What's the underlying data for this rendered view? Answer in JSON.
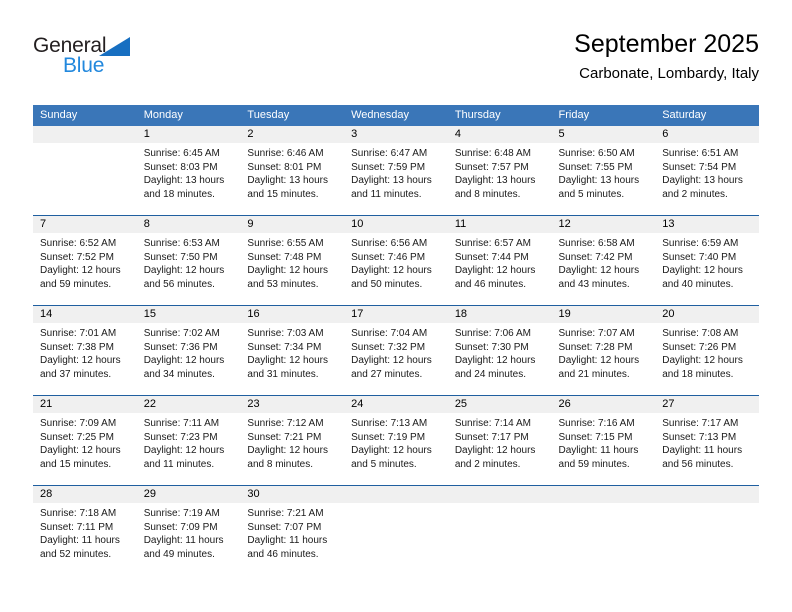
{
  "brand": {
    "name_part1": "General",
    "name_part2": "Blue",
    "triangle_icon": "triangle-icon",
    "colors": {
      "dark": "#231f20",
      "blue": "#2288dd",
      "triangle": "#176fc1"
    }
  },
  "header": {
    "title": "September 2025",
    "subtitle": "Carbonate, Lombardy, Italy"
  },
  "calendar": {
    "header_bg": "#3a76b8",
    "daynum_bg": "#f0f0f0",
    "row_divider": "#1f5fa0",
    "weekdays": [
      "Sunday",
      "Monday",
      "Tuesday",
      "Wednesday",
      "Thursday",
      "Friday",
      "Saturday"
    ],
    "weeks": [
      [
        {
          "day": "",
          "sunrise": "",
          "sunset": "",
          "daylight1": "",
          "daylight2": "",
          "empty": true
        },
        {
          "day": "1",
          "sunrise": "Sunrise: 6:45 AM",
          "sunset": "Sunset: 8:03 PM",
          "daylight1": "Daylight: 13 hours",
          "daylight2": "and 18 minutes."
        },
        {
          "day": "2",
          "sunrise": "Sunrise: 6:46 AM",
          "sunset": "Sunset: 8:01 PM",
          "daylight1": "Daylight: 13 hours",
          "daylight2": "and 15 minutes."
        },
        {
          "day": "3",
          "sunrise": "Sunrise: 6:47 AM",
          "sunset": "Sunset: 7:59 PM",
          "daylight1": "Daylight: 13 hours",
          "daylight2": "and 11 minutes."
        },
        {
          "day": "4",
          "sunrise": "Sunrise: 6:48 AM",
          "sunset": "Sunset: 7:57 PM",
          "daylight1": "Daylight: 13 hours",
          "daylight2": "and 8 minutes."
        },
        {
          "day": "5",
          "sunrise": "Sunrise: 6:50 AM",
          "sunset": "Sunset: 7:55 PM",
          "daylight1": "Daylight: 13 hours",
          "daylight2": "and 5 minutes."
        },
        {
          "day": "6",
          "sunrise": "Sunrise: 6:51 AM",
          "sunset": "Sunset: 7:54 PM",
          "daylight1": "Daylight: 13 hours",
          "daylight2": "and 2 minutes."
        }
      ],
      [
        {
          "day": "7",
          "sunrise": "Sunrise: 6:52 AM",
          "sunset": "Sunset: 7:52 PM",
          "daylight1": "Daylight: 12 hours",
          "daylight2": "and 59 minutes."
        },
        {
          "day": "8",
          "sunrise": "Sunrise: 6:53 AM",
          "sunset": "Sunset: 7:50 PM",
          "daylight1": "Daylight: 12 hours",
          "daylight2": "and 56 minutes."
        },
        {
          "day": "9",
          "sunrise": "Sunrise: 6:55 AM",
          "sunset": "Sunset: 7:48 PM",
          "daylight1": "Daylight: 12 hours",
          "daylight2": "and 53 minutes."
        },
        {
          "day": "10",
          "sunrise": "Sunrise: 6:56 AM",
          "sunset": "Sunset: 7:46 PM",
          "daylight1": "Daylight: 12 hours",
          "daylight2": "and 50 minutes."
        },
        {
          "day": "11",
          "sunrise": "Sunrise: 6:57 AM",
          "sunset": "Sunset: 7:44 PM",
          "daylight1": "Daylight: 12 hours",
          "daylight2": "and 46 minutes."
        },
        {
          "day": "12",
          "sunrise": "Sunrise: 6:58 AM",
          "sunset": "Sunset: 7:42 PM",
          "daylight1": "Daylight: 12 hours",
          "daylight2": "and 43 minutes."
        },
        {
          "day": "13",
          "sunrise": "Sunrise: 6:59 AM",
          "sunset": "Sunset: 7:40 PM",
          "daylight1": "Daylight: 12 hours",
          "daylight2": "and 40 minutes."
        }
      ],
      [
        {
          "day": "14",
          "sunrise": "Sunrise: 7:01 AM",
          "sunset": "Sunset: 7:38 PM",
          "daylight1": "Daylight: 12 hours",
          "daylight2": "and 37 minutes."
        },
        {
          "day": "15",
          "sunrise": "Sunrise: 7:02 AM",
          "sunset": "Sunset: 7:36 PM",
          "daylight1": "Daylight: 12 hours",
          "daylight2": "and 34 minutes."
        },
        {
          "day": "16",
          "sunrise": "Sunrise: 7:03 AM",
          "sunset": "Sunset: 7:34 PM",
          "daylight1": "Daylight: 12 hours",
          "daylight2": "and 31 minutes."
        },
        {
          "day": "17",
          "sunrise": "Sunrise: 7:04 AM",
          "sunset": "Sunset: 7:32 PM",
          "daylight1": "Daylight: 12 hours",
          "daylight2": "and 27 minutes."
        },
        {
          "day": "18",
          "sunrise": "Sunrise: 7:06 AM",
          "sunset": "Sunset: 7:30 PM",
          "daylight1": "Daylight: 12 hours",
          "daylight2": "and 24 minutes."
        },
        {
          "day": "19",
          "sunrise": "Sunrise: 7:07 AM",
          "sunset": "Sunset: 7:28 PM",
          "daylight1": "Daylight: 12 hours",
          "daylight2": "and 21 minutes."
        },
        {
          "day": "20",
          "sunrise": "Sunrise: 7:08 AM",
          "sunset": "Sunset: 7:26 PM",
          "daylight1": "Daylight: 12 hours",
          "daylight2": "and 18 minutes."
        }
      ],
      [
        {
          "day": "21",
          "sunrise": "Sunrise: 7:09 AM",
          "sunset": "Sunset: 7:25 PM",
          "daylight1": "Daylight: 12 hours",
          "daylight2": "and 15 minutes."
        },
        {
          "day": "22",
          "sunrise": "Sunrise: 7:11 AM",
          "sunset": "Sunset: 7:23 PM",
          "daylight1": "Daylight: 12 hours",
          "daylight2": "and 11 minutes."
        },
        {
          "day": "23",
          "sunrise": "Sunrise: 7:12 AM",
          "sunset": "Sunset: 7:21 PM",
          "daylight1": "Daylight: 12 hours",
          "daylight2": "and 8 minutes."
        },
        {
          "day": "24",
          "sunrise": "Sunrise: 7:13 AM",
          "sunset": "Sunset: 7:19 PM",
          "daylight1": "Daylight: 12 hours",
          "daylight2": "and 5 minutes."
        },
        {
          "day": "25",
          "sunrise": "Sunrise: 7:14 AM",
          "sunset": "Sunset: 7:17 PM",
          "daylight1": "Daylight: 12 hours",
          "daylight2": "and 2 minutes."
        },
        {
          "day": "26",
          "sunrise": "Sunrise: 7:16 AM",
          "sunset": "Sunset: 7:15 PM",
          "daylight1": "Daylight: 11 hours",
          "daylight2": "and 59 minutes."
        },
        {
          "day": "27",
          "sunrise": "Sunrise: 7:17 AM",
          "sunset": "Sunset: 7:13 PM",
          "daylight1": "Daylight: 11 hours",
          "daylight2": "and 56 minutes."
        }
      ],
      [
        {
          "day": "28",
          "sunrise": "Sunrise: 7:18 AM",
          "sunset": "Sunset: 7:11 PM",
          "daylight1": "Daylight: 11 hours",
          "daylight2": "and 52 minutes."
        },
        {
          "day": "29",
          "sunrise": "Sunrise: 7:19 AM",
          "sunset": "Sunset: 7:09 PM",
          "daylight1": "Daylight: 11 hours",
          "daylight2": "and 49 minutes."
        },
        {
          "day": "30",
          "sunrise": "Sunrise: 7:21 AM",
          "sunset": "Sunset: 7:07 PM",
          "daylight1": "Daylight: 11 hours",
          "daylight2": "and 46 minutes."
        },
        {
          "day": "",
          "sunrise": "",
          "sunset": "",
          "daylight1": "",
          "daylight2": "",
          "empty": true
        },
        {
          "day": "",
          "sunrise": "",
          "sunset": "",
          "daylight1": "",
          "daylight2": "",
          "empty": true
        },
        {
          "day": "",
          "sunrise": "",
          "sunset": "",
          "daylight1": "",
          "daylight2": "",
          "empty": true
        },
        {
          "day": "",
          "sunrise": "",
          "sunset": "",
          "daylight1": "",
          "daylight2": "",
          "empty": true
        }
      ]
    ]
  }
}
